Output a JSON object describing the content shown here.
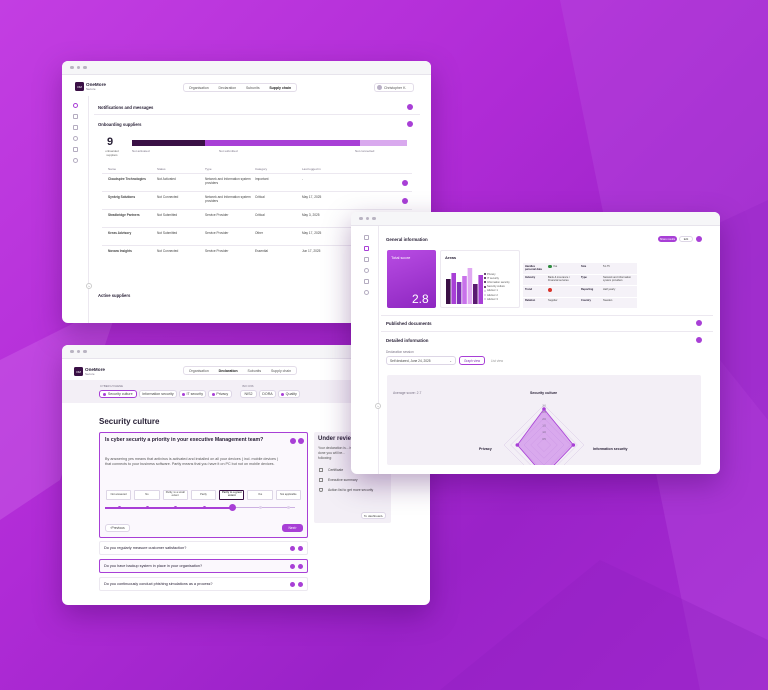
{
  "colors": {
    "primary": "#a83fd6",
    "dark": "#3a1045",
    "accent": "#7d2fb4",
    "background": "#b634dc"
  },
  "brand": {
    "name": "OneMore",
    "sub": "Secure",
    "logo": "OM"
  },
  "win1": {
    "tabs": [
      "Organisation",
      "Declaration",
      "Subunits",
      "Supply chain"
    ],
    "user": "Christopher K.",
    "sections": {
      "notifications": "Notifications and messages",
      "onboarding": "Onboarding suppliers",
      "active": "Active suppliers"
    },
    "summary": {
      "count": "9",
      "count_label": "onboarded suppliers",
      "bar_labels": [
        "Not activated",
        "Not submitted",
        "Not connected"
      ],
      "bar_fractions": [
        0.23,
        0.49,
        0.15
      ]
    },
    "table": {
      "headers": [
        "Name",
        "Status",
        "Type",
        "Category",
        "Last logged in"
      ],
      "rows": [
        [
          "Cloudspire Technologies",
          "Not Activated",
          "Network and Information system providers",
          "Important",
          "-"
        ],
        [
          "Synkrig Solutions",
          "Not Connected",
          "Network and Information system providers",
          "Critical",
          "May 17, 2025"
        ],
        [
          "Stradbridge Partners",
          "Not Submitted",
          "Service Provider",
          "Critical",
          "May 3, 2025"
        ],
        [
          "Kreas Advisory",
          "Not Submitted",
          "Service Provider",
          "Other",
          "May 17, 2025"
        ],
        [
          "Novara Insights",
          "Not Connected",
          "Service Provider",
          "Essential",
          "Jun 17, 2025"
        ]
      ]
    }
  },
  "win2": {
    "tabs": [
      "Organisation",
      "Declaration",
      "Subunits",
      "Supply chain"
    ],
    "group1_label": "CYBER HYGIENE",
    "group2_label": "ISO CNS",
    "chips": [
      "Security culture",
      "Information security",
      "IT security",
      "Privacy",
      "NIS2",
      "DORA",
      "Quality"
    ],
    "section_title": "Security culture",
    "question": "Is cyber security a priority in your executive Management team?",
    "explanation": "By answering yes means that antivirus is activated and installed on all your devices ( incl. mobile devices ) that connects to your business software. Partly means that you have it on PC but not on mobile devices.",
    "scale": [
      "Not answered",
      "No",
      "Partly, to a small extent",
      "Partly",
      "Partly to a great extent",
      "Yes",
      "Not applicable"
    ],
    "prev": "Previous",
    "next": "Next",
    "questions": [
      "Do you regularly measure customer satisfaction?",
      "Do you have backup system in place in your organisation?",
      "Do you continuously conduct phishing simulations as a process?"
    ],
    "review_title": "Under review",
    "review_text": "Your declaration is... is done you will be... following:",
    "review_items": [
      "Certificate",
      "Executive summary",
      "Action list to get more security"
    ],
    "review_button": "To dashboard"
  },
  "win3": {
    "title": "General information",
    "btn1": "Share results",
    "btn2": "Edit",
    "total_label": "Total score",
    "total_value": "2.8",
    "areas_label": "Areas",
    "bar_values": [
      2.5,
      3.1,
      2.2,
      2.8,
      3.6,
      2.0,
      2.9
    ],
    "legend": [
      "Privacy",
      "IT security",
      "Information security",
      "Security culture",
      "Advisor 1",
      "Advisor 2",
      "Advisor 3"
    ],
    "info": [
      [
        "Handles personal data",
        "Yes",
        "Size",
        "51-75"
      ],
      [
        "Industry",
        "Bank & insurance / Financial services",
        "Type",
        "Network and information system providers"
      ],
      [
        "Trend",
        "",
        "Reporting",
        "Half yearly"
      ],
      [
        "Relation",
        "Supplier",
        "Country",
        "Sweden"
      ]
    ],
    "published": "Published documents",
    "detailed": "Detailed information",
    "session_label": "Declaration session",
    "session_value": "Self declared, June 24, 2025",
    "view_graph": "Graph view",
    "view_list": "List view",
    "avg": "Average score: 2.7",
    "radar": {
      "axes": [
        "Security culture",
        "Information security",
        "Privacy"
      ],
      "ticks": [
        "3.0",
        "2.5",
        "2.0",
        "1.5",
        "1.0",
        "0.5"
      ],
      "values": [
        2.7,
        2.2,
        2.3,
        2.0
      ],
      "max": 3
    }
  }
}
